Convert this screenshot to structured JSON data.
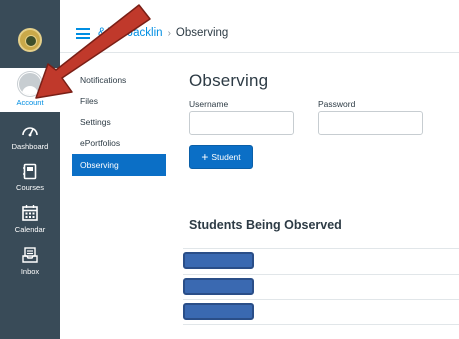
{
  "global_nav": {
    "items": [
      {
        "label": "Account",
        "icon": "user-avatar-icon"
      },
      {
        "label": "Dashboard",
        "icon": "dashboard-gauge-icon"
      },
      {
        "label": "Courses",
        "icon": "courses-book-icon"
      },
      {
        "label": "Calendar",
        "icon": "calendar-icon"
      },
      {
        "label": "Inbox",
        "icon": "inbox-tray-icon"
      }
    ],
    "colors": {
      "background": "#394b58",
      "active_text": "#008ee2"
    }
  },
  "header": {
    "breadcrumb_user": "&Jen Jacklin",
    "breadcrumb_separator": "›",
    "breadcrumb_current": "Observing"
  },
  "section_nav": {
    "items": [
      "Notifications",
      "Files",
      "Settings",
      "ePortfolios",
      "Observing"
    ],
    "active": "Observing"
  },
  "main": {
    "title": "Observing",
    "username_label": "Username",
    "password_label": "Password",
    "username_value": "",
    "password_value": "",
    "add_button_label": "Student",
    "add_button_icon": "plus-icon",
    "students_heading": "Students Being Observed",
    "observed_students_count": 3
  },
  "annotation": {
    "type": "red-arrow",
    "points_to": "Account",
    "color": "#c0392b"
  },
  "colors": {
    "accent": "#008ee2",
    "button": "#0b6fc6",
    "redacted_student": "#3a69b1"
  }
}
